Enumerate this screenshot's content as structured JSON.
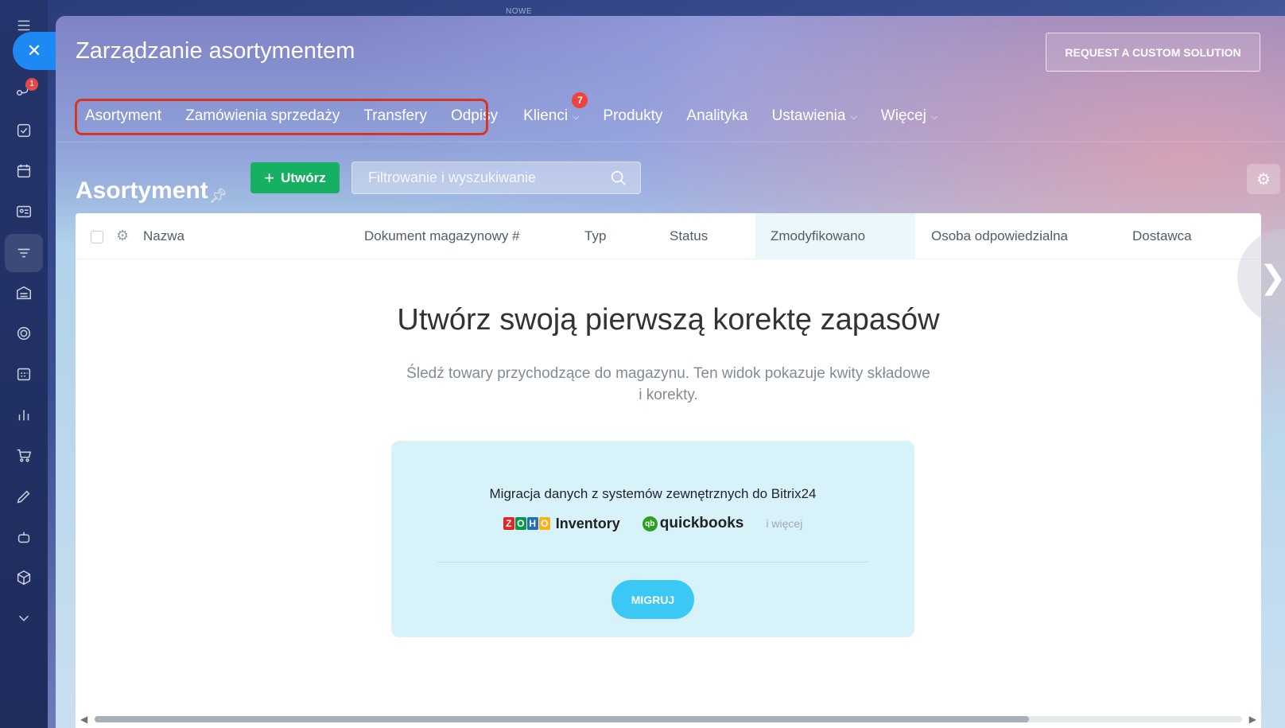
{
  "top_label": "NOWE",
  "rail": {
    "badge": "1",
    "icons": [
      "menu-icon",
      "close-icon",
      "flow-icon",
      "tasks-icon",
      "calendar-icon",
      "contacts-icon",
      "filter-icon",
      "warehouse-icon",
      "target-icon",
      "schedule-icon",
      "chart-icon",
      "cart-icon",
      "pen-icon",
      "robot-icon",
      "cube-icon",
      "chevron-down-icon"
    ]
  },
  "header": {
    "title": "Zarządzanie asortymentem",
    "request_button": "REQUEST A CUSTOM SOLUTION"
  },
  "tabs": [
    {
      "label": "Asortyment"
    },
    {
      "label": "Zamówienia sprzedaży"
    },
    {
      "label": "Transfery"
    },
    {
      "label": "Odpisy"
    },
    {
      "label": "Klienci",
      "badge": "7",
      "dropdown": true
    },
    {
      "label": "Produkty"
    },
    {
      "label": "Analityka"
    },
    {
      "label": "Ustawienia",
      "dropdown": true
    },
    {
      "label": "Więcej",
      "dropdown": true
    }
  ],
  "toolbar": {
    "page_title": "Asortyment",
    "create_label": "Utwórz",
    "search_placeholder": "Filtrowanie i wyszukiwanie"
  },
  "grid": {
    "columns": [
      "Nazwa",
      "Dokument magazynowy #",
      "Typ",
      "Status",
      "Zmodyfikowano",
      "Osoba odpowiedzialna",
      "Dostawca"
    ],
    "sorted_column": "Zmodyfikowano"
  },
  "empty_state": {
    "title": "Utwórz swoją pierwszą korektę zapasów",
    "description": "Śledź towary przychodzące do magazynu. Ten widok pokazuje kwity składowe i korekty."
  },
  "migration": {
    "title": "Migracja danych z systemów zewnętrznych do Bitrix24",
    "zoho_label": "Inventory",
    "quickbooks_label": "quickbooks",
    "more_label": "i więcej",
    "button": "MIGRUJ"
  }
}
